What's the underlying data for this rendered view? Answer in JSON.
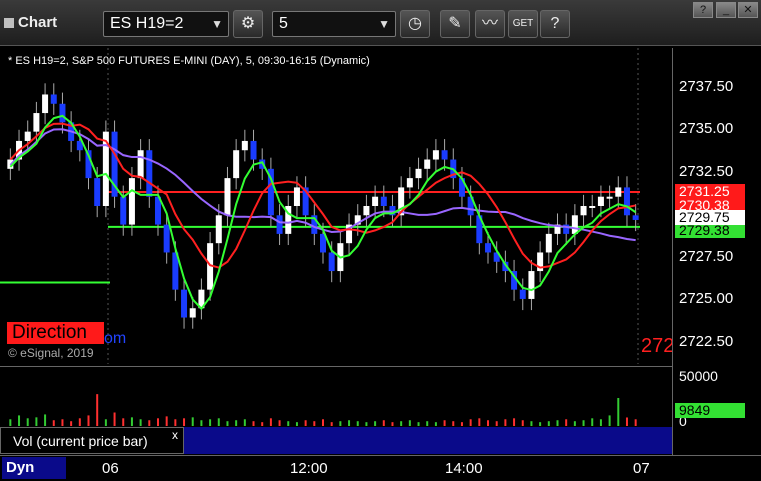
{
  "window": {
    "title": "Chart",
    "symbol": "ES H19=2",
    "interval": "5",
    "buttons": [
      "clock",
      "pen",
      "studies",
      "get",
      "help"
    ]
  },
  "header": {
    "info": "* ES H19=2, S&P 500 FUTURES E-MINI (DAY), 5, 09:30-16:15 (Dynamic)"
  },
  "price_axis": {
    "ticks": [
      "2737.50",
      "2735.00",
      "2732.50",
      "2730.00",
      "2727.50",
      "2725.00",
      "2722.50"
    ],
    "labels": {
      "upper": "2731.25",
      "mid": "2730.38",
      "last": "2729.75",
      "lower": "2729.38"
    }
  },
  "overlays": {
    "direction": "Direction",
    "direction_suffix": "om",
    "copyright": "© eSignal, 2019",
    "right_price": "272"
  },
  "volume": {
    "label": "Vol (current price bar)",
    "close": "x",
    "ticks": [
      "50000",
      "0"
    ],
    "last": "9849"
  },
  "time_axis": {
    "dyn": "Dyn",
    "ticks": [
      "06",
      "12:00",
      "14:00",
      "07"
    ]
  },
  "chart_data": {
    "type": "candlestick",
    "ylim": [
      2722.0,
      2739.0
    ],
    "levels": {
      "red_upper": 2731.25,
      "green_lower": 2729.38,
      "red_bottom": 2722.5,
      "green_far": 2728.0
    },
    "closes": [
      2733.0,
      2734.0,
      2734.5,
      2735.5,
      2736.5,
      2736.0,
      2735.0,
      2734.0,
      2733.5,
      2732.0,
      2730.5,
      2734.5,
      2731.0,
      2729.5,
      2732.0,
      2733.5,
      2731.0,
      2729.5,
      2728.0,
      2726.0,
      2724.5,
      2725.0,
      2726.0,
      2728.5,
      2730.0,
      2732.0,
      2733.5,
      2734.0,
      2733.0,
      2732.5,
      2730.0,
      2729.0,
      2730.5,
      2731.5,
      2730.0,
      2729.0,
      2728.0,
      2727.0,
      2728.5,
      2729.5,
      2730.0,
      2730.5,
      2731.0,
      2730.5,
      2730.0,
      2731.5,
      2732.0,
      2732.5,
      2733.0,
      2733.5,
      2733.0,
      2732.0,
      2731.0,
      2730.0,
      2728.5,
      2728.0,
      2727.5,
      2727.0,
      2726.0,
      2725.5,
      2727.0,
      2728.0,
      2729.0,
      2729.5,
      2729.0,
      2730.0,
      2730.5,
      2730.5,
      2731.0,
      2731.0,
      2731.5,
      2730.0,
      2729.75
    ],
    "volumes": [
      8000,
      12000,
      9000,
      10000,
      13000,
      7000,
      8000,
      6000,
      9000,
      12000,
      34000,
      8000,
      15000,
      9000,
      10000,
      8000,
      7000,
      9000,
      11000,
      8000,
      9000,
      10000,
      7000,
      8000,
      9000,
      6000,
      7000,
      8000,
      6000,
      5000,
      9000,
      7000,
      6000,
      5000,
      7000,
      6000,
      8000,
      5000,
      6000,
      7000,
      6000,
      5000,
      6000,
      7000,
      5000,
      6000,
      7000,
      5000,
      6000,
      5000,
      7000,
      6000,
      5000,
      8000,
      9000,
      7000,
      6000,
      8000,
      9000,
      7000,
      6000,
      5000,
      6000,
      7000,
      8000,
      6000,
      7000,
      9000,
      8000,
      12000,
      30000,
      9849,
      8000
    ]
  }
}
